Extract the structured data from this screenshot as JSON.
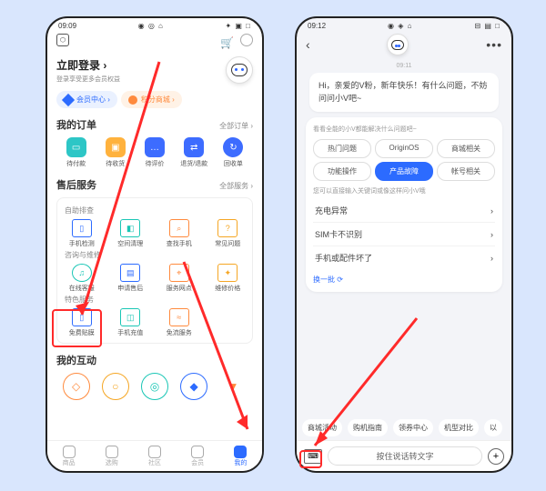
{
  "left": {
    "status": {
      "time": "09:09",
      "icons_l": "◉ ◎ ⌂",
      "icons_r": "✦ ▣ □"
    },
    "topbar": {
      "badge": "⬡",
      "cart": "🛒"
    },
    "login": {
      "title": "立即登录 ›",
      "subtitle": "登录享受更多会员权益"
    },
    "pills": {
      "member": "会员中心 ›",
      "points": "积分商城 ›"
    },
    "orders": {
      "title": "我的订单",
      "more": "全部订单 ›",
      "items": [
        "待付款",
        "待收货",
        "待评价",
        "退货/退款",
        "回收单"
      ]
    },
    "service": {
      "title": "售后服务",
      "more": "全部服务 ›",
      "grp1_title": "自助排查",
      "grp1": [
        "手机检测",
        "空间清理",
        "查找手机",
        "常见问题"
      ],
      "grp2_title": "咨询与维修",
      "grp2": [
        "在线客服",
        "申请售后",
        "服务网点",
        "维修价格"
      ],
      "grp3_title": "特色服务",
      "grp3": [
        "免费贴膜",
        "手机充值",
        "免流服务"
      ]
    },
    "inter": {
      "title": "我的互动"
    },
    "tabs": [
      "商品",
      "选购",
      "社区",
      "会员",
      "我的"
    ]
  },
  "right": {
    "status": {
      "time": "09:12",
      "icons_l": "◉ ◈ ⌂",
      "icons_r": "⊟ ▤ □"
    },
    "top": {
      "back": "‹",
      "dots": "•••"
    },
    "time_stamp": "09:11",
    "greet": "Hi，亲爱的V粉，新年快乐！有什么问题，不妨问问小V吧~",
    "card": {
      "sub": "看看全能的小V都能解决什么问题吧~",
      "chips1": [
        "热门问题",
        "OriginOS",
        "商城相关"
      ],
      "chips2": [
        "功能操作",
        "产品故障",
        "帐号相关"
      ],
      "tip": "您可以直接输入关键词或像这样问小V哦",
      "list": [
        "充电异常",
        "SIM卡不识别",
        "手机或配件坏了"
      ],
      "more": "换一批 ⟳"
    },
    "chips_bottom": [
      "商城活动",
      "购机指南",
      "领券中心",
      "机型对比",
      "以"
    ],
    "input": {
      "hold": "按住说话转文字"
    }
  }
}
